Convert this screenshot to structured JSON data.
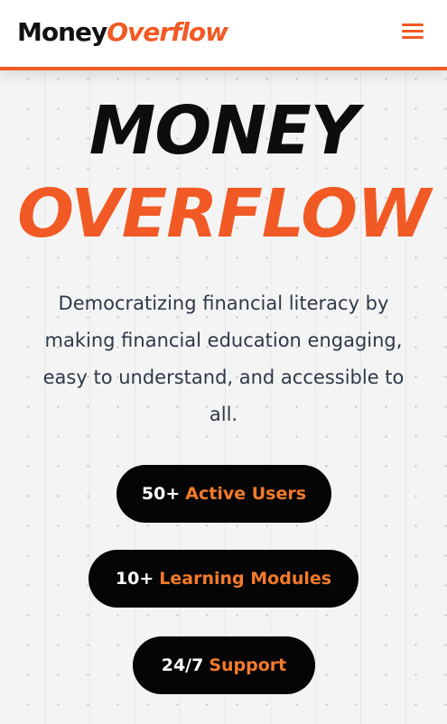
{
  "header": {
    "logo_money": "Money",
    "logo_overflow": "Overflow",
    "menu_icon": "hamburger-menu-icon"
  },
  "hero": {
    "title_line1": "MONEY",
    "title_line2": "OVERFLOW",
    "tagline": "Democratizing financial literacy by making financial education engaging, easy to understand, and accessible to all."
  },
  "stats": [
    {
      "number": "50+",
      "label": "Active Users"
    },
    {
      "number": "10+",
      "label": "Learning Modules"
    },
    {
      "number": "24/7",
      "label": "Support"
    }
  ],
  "colors": {
    "accent": "#f15a24",
    "dark": "#050505",
    "text": "#2f3848",
    "background": "#f4f4f4"
  }
}
